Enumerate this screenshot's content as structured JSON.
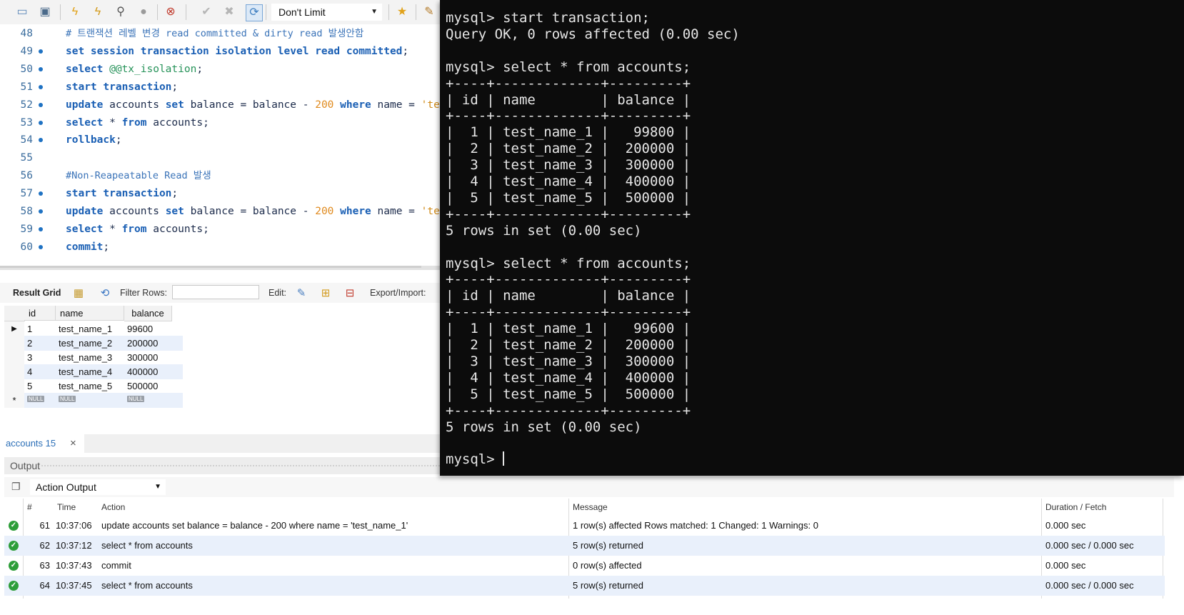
{
  "toolbar": {
    "limit_label": "Don't Limit",
    "icons": [
      "open-folder-icon",
      "save-icon",
      "execute-icon",
      "execute-current-icon",
      "explain-icon",
      "stop-icon",
      "toggle-stop-on-error-icon",
      "commit-icon",
      "rollback-icon",
      "autocommit-icon",
      "add-snippet-star-icon",
      "beautify-brush-icon"
    ]
  },
  "editor": {
    "lines": [
      {
        "n": "48",
        "dot": false,
        "tokens": [
          {
            "c": "cmt",
            "t": "# 트랜잭션 레벨 변경 read committed & dirty read 발생안함"
          }
        ]
      },
      {
        "n": "49",
        "dot": true,
        "tokens": [
          {
            "c": "kw",
            "t": "set session transaction isolation level read committed"
          },
          {
            "c": "id",
            "t": ";"
          }
        ]
      },
      {
        "n": "50",
        "dot": true,
        "tokens": [
          {
            "c": "kw",
            "t": "select "
          },
          {
            "c": "var",
            "t": "@@tx_isolation"
          },
          {
            "c": "id",
            "t": ";"
          }
        ]
      },
      {
        "n": "51",
        "dot": true,
        "tokens": [
          {
            "c": "kw",
            "t": "start transaction"
          },
          {
            "c": "id",
            "t": ";"
          }
        ]
      },
      {
        "n": "52",
        "dot": true,
        "tokens": [
          {
            "c": "kw",
            "t": "update "
          },
          {
            "c": "id",
            "t": "accounts "
          },
          {
            "c": "kw",
            "t": "set "
          },
          {
            "c": "id",
            "t": "balance = balance - "
          },
          {
            "c": "num",
            "t": "200 "
          },
          {
            "c": "kw",
            "t": "where "
          },
          {
            "c": "id",
            "t": "name = "
          },
          {
            "c": "str",
            "t": "'te"
          }
        ]
      },
      {
        "n": "53",
        "dot": true,
        "tokens": [
          {
            "c": "kw",
            "t": "select "
          },
          {
            "c": "id",
            "t": "* "
          },
          {
            "c": "kw",
            "t": "from "
          },
          {
            "c": "id",
            "t": "accounts;"
          }
        ]
      },
      {
        "n": "54",
        "dot": true,
        "tokens": [
          {
            "c": "kw",
            "t": "rollback"
          },
          {
            "c": "id",
            "t": ";"
          }
        ]
      },
      {
        "n": "55",
        "dot": false,
        "tokens": []
      },
      {
        "n": "56",
        "dot": false,
        "tokens": [
          {
            "c": "cmt",
            "t": "#Non-Reapeatable Read 발생"
          }
        ]
      },
      {
        "n": "57",
        "dot": true,
        "tokens": [
          {
            "c": "kw",
            "t": "start transaction"
          },
          {
            "c": "id",
            "t": ";"
          }
        ]
      },
      {
        "n": "58",
        "dot": true,
        "tokens": [
          {
            "c": "kw",
            "t": "update "
          },
          {
            "c": "id",
            "t": "accounts "
          },
          {
            "c": "kw",
            "t": "set "
          },
          {
            "c": "id",
            "t": "balance = balance - "
          },
          {
            "c": "num",
            "t": "200 "
          },
          {
            "c": "kw",
            "t": "where "
          },
          {
            "c": "id",
            "t": "name = "
          },
          {
            "c": "str",
            "t": "'te"
          }
        ]
      },
      {
        "n": "59",
        "dot": true,
        "tokens": [
          {
            "c": "kw",
            "t": "select "
          },
          {
            "c": "id",
            "t": "* "
          },
          {
            "c": "kw",
            "t": "from "
          },
          {
            "c": "id",
            "t": "accounts;"
          }
        ]
      },
      {
        "n": "60",
        "dot": true,
        "tokens": [
          {
            "c": "kw",
            "t": "commit"
          },
          {
            "c": "id",
            "t": ";"
          }
        ]
      }
    ]
  },
  "result_toolbar": {
    "result_grid": "Result Grid",
    "filter_rows": "Filter Rows:",
    "edit": "Edit:",
    "export_import": "Export/Import:"
  },
  "grid": {
    "headers": [
      "id",
      "name",
      "balance"
    ],
    "rows": [
      [
        "1",
        "test_name_1",
        "99600"
      ],
      [
        "2",
        "test_name_2",
        "200000"
      ],
      [
        "3",
        "test_name_3",
        "300000"
      ],
      [
        "4",
        "test_name_4",
        "400000"
      ],
      [
        "5",
        "test_name_5",
        "500000"
      ]
    ],
    "null_label": "NULL"
  },
  "tabs": {
    "active": "accounts 15",
    "close": "×"
  },
  "output": {
    "title": "Output",
    "selector": "Action Output",
    "headers": {
      "num": "#",
      "time": "Time",
      "action": "Action",
      "message": "Message",
      "duration": "Duration / Fetch"
    },
    "rows": [
      {
        "num": "61",
        "time": "10:37:06",
        "action": "update accounts set balance = balance - 200 where name = 'test_name_1'",
        "message": "1 row(s) affected Rows matched: 1  Changed: 1  Warnings: 0",
        "duration": "0.000 sec"
      },
      {
        "num": "62",
        "time": "10:37:12",
        "action": "select * from accounts",
        "message": "5 row(s) returned",
        "duration": "0.000 sec / 0.000 sec"
      },
      {
        "num": "63",
        "time": "10:37:43",
        "action": "commit",
        "message": "0 row(s) affected",
        "duration": "0.000 sec"
      },
      {
        "num": "64",
        "time": "10:37:45",
        "action": "select * from accounts",
        "message": "5 row(s) returned",
        "duration": "0.000 sec / 0.000 sec"
      }
    ]
  },
  "terminal": {
    "lines": [
      "mysql> start transaction;",
      "Query OK, 0 rows affected (0.00 sec)",
      "",
      "mysql> select * from accounts;",
      "+----+-------------+---------+",
      "| id | name        | balance |",
      "+----+-------------+---------+",
      "|  1 | test_name_1 |   99800 |",
      "|  2 | test_name_2 |  200000 |",
      "|  3 | test_name_3 |  300000 |",
      "|  4 | test_name_4 |  400000 |",
      "|  5 | test_name_5 |  500000 |",
      "+----+-------------+---------+",
      "5 rows in set (0.00 sec)",
      "",
      "mysql> select * from accounts;",
      "+----+-------------+---------+",
      "| id | name        | balance |",
      "+----+-------------+---------+",
      "|  1 | test_name_1 |   99600 |",
      "|  2 | test_name_2 |  200000 |",
      "|  3 | test_name_3 |  300000 |",
      "|  4 | test_name_4 |  400000 |",
      "|  5 | test_name_5 |  500000 |",
      "+----+-------------+---------+",
      "5 rows in set (0.00 sec)",
      "",
      "mysql> "
    ]
  }
}
